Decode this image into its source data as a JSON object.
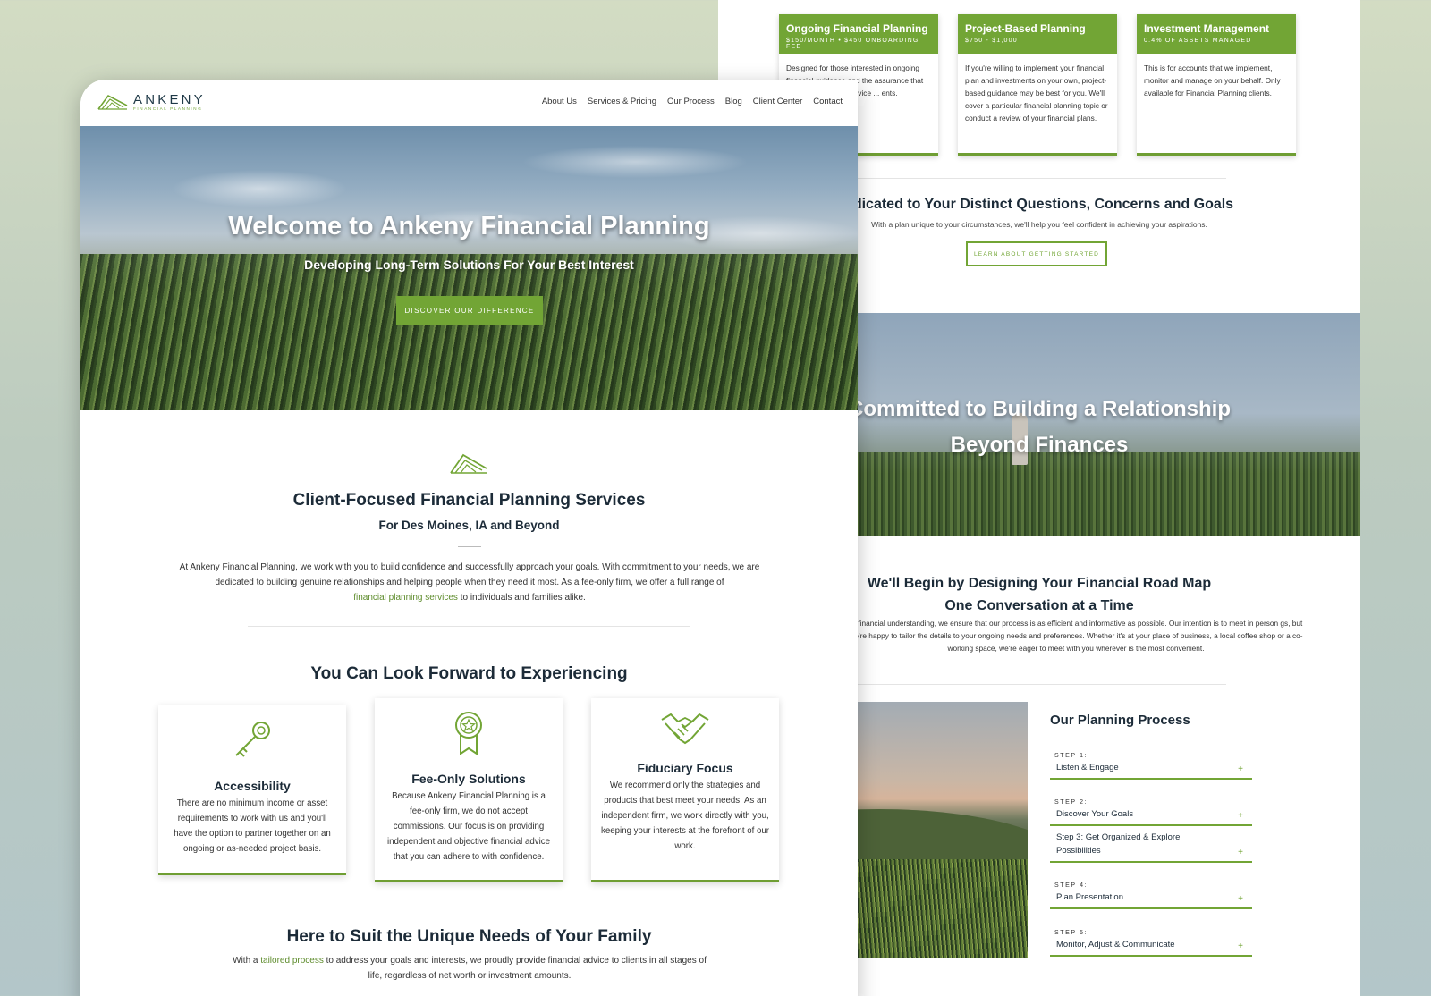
{
  "back": {
    "services": [
      {
        "title": "Ongoing Financial Planning",
        "price": "$150/MONTH • $450 ONBOARDING FEE",
        "body": "Designed for those interested in ongoing financial guidance and the assurance that we're there to offer advice ... ents."
      },
      {
        "title": "Project-Based Planning",
        "price": "$750 - $1,000",
        "body": "If you're willing to implement your financial plan and investments on your own, project-based guidance may be best for you. We'll cover a particular financial planning topic or conduct a review of your financial plans."
      },
      {
        "title": "Investment Management",
        "price": "0.4% OF ASSETS MANAGED",
        "body": "This is for accounts that we implement, monitor and manage on your behalf. Only available for Financial Planning clients."
      }
    ],
    "dedicated_title": "edicated to Your Distinct Questions, Concerns and Goals",
    "dedicated_sub": "With a plan unique to your circumstances, we'll help you feel confident in achieving your aspirations.",
    "learn_button": "LEARN ABOUT GETTING STARTED",
    "commit_line1": "Committed to Building a Relationship",
    "commit_line2": "Beyond Finances",
    "road_line1": "We'll Begin by Designing Your Financial Road Map",
    "road_line2": "One Conversation at a Time",
    "road_body": "ur financial understanding, we ensure that our process is as efficient and informative as possible. Our intention is to meet in person gs, but we're happy to tailor the details to your ongoing needs and preferences. Whether it's at your place of business, a local coffee shop or a co-working space, we're eager to meet with you wherever is the most convenient.",
    "process_title": "Our Planning Process",
    "steps": [
      {
        "num": "STEP 1:",
        "label": "Listen & Engage"
      },
      {
        "num": "STEP 2:",
        "label": "Discover Your Goals"
      },
      {
        "num": "",
        "label": "Step 3: Get Organized & Explore Possibilities"
      },
      {
        "num": "STEP 4:",
        "label": "Plan Presentation"
      },
      {
        "num": "STEP 5:",
        "label": "Monitor, Adjust & Communicate"
      }
    ],
    "plus": "+"
  },
  "front": {
    "logo_text": "ANKENY",
    "logo_sub": "FINANCIAL PLANNING",
    "nav": [
      "About Us",
      "Services & Pricing",
      "Our Process",
      "Blog",
      "Client Center",
      "Contact"
    ],
    "hero_title": "Welcome to Ankeny Financial Planning",
    "hero_sub": "Developing Long-Term Solutions For Your Best Interest",
    "hero_button": "DISCOVER OUR DIFFERENCE",
    "cf_title": "Client-Focused Financial Planning Services",
    "cf_sub": "For Des Moines, IA and Beyond",
    "cf_body_1": "At Ankeny Financial Planning, we work with you to build confidence and successfully approach your goals. With commitment to your needs, we are dedicated to building genuine relationships and helping people when they need it most. As a fee-only firm, we offer a full range of",
    "cf_link": "financial planning services",
    "cf_body_2": " to individuals and families alike.",
    "lf_title": "You Can Look Forward to Experiencing",
    "features": [
      {
        "title": "Accessibility",
        "body": "There are no minimum income or asset requirements to work with us and you'll have the option to partner together on an ongoing or as-needed project basis."
      },
      {
        "title": "Fee-Only Solutions",
        "body": "Because Ankeny Financial Planning is a fee-only firm, we do not accept commissions. Our focus is on providing independent and objective financial advice that you can adhere to with confidence."
      },
      {
        "title": "Fiduciary Focus",
        "body": "We recommend only the strategies and products that best meet your needs. As an independent firm, we work directly with you, keeping your interests at the forefront of our work."
      }
    ],
    "unique_title": "Here to Suit the Unique Needs of Your Family",
    "unique_pre": "With a ",
    "unique_link": "tailored process",
    "unique_post": " to address your goals and interests, we proudly provide financial advice to clients in all stages of life, regardless of net worth or investment amounts."
  },
  "colors": {
    "accent": "#72a535",
    "heading": "#1c2b38",
    "logo_navy": "#1f3947"
  },
  "icons": [
    "logo-mark-icon",
    "key-icon",
    "award-ribbon-icon",
    "handshake-icon",
    "plus-icon"
  ]
}
